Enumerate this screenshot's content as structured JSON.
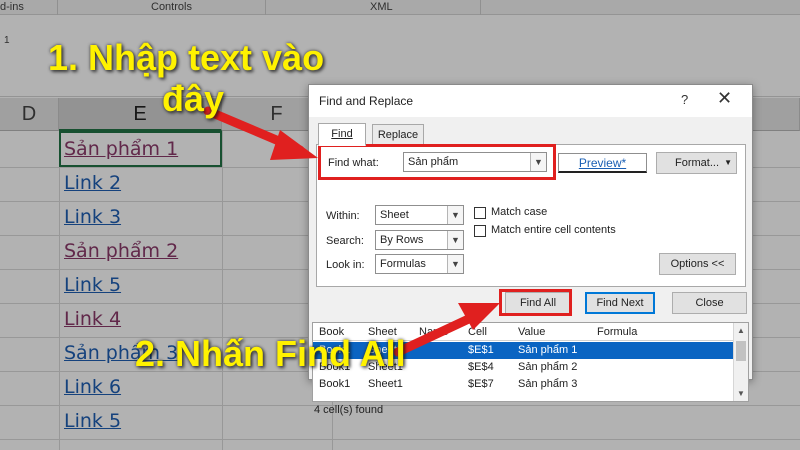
{
  "ribbon": {
    "addins": "d-ins",
    "controls": "Controls",
    "xml": "XML"
  },
  "formula_row_number": "1",
  "columns": {
    "d": "D",
    "e": "E",
    "f": "F"
  },
  "cells": [
    {
      "text": "Sản phẩm 1",
      "style": "visited"
    },
    {
      "text": "Link 2",
      "style": "link"
    },
    {
      "text": "Link 3",
      "style": "link"
    },
    {
      "text": "Sản phẩm 2",
      "style": "visited"
    },
    {
      "text": "Link 5",
      "style": "link"
    },
    {
      "text": "Link 4",
      "style": "visited"
    },
    {
      "text": "Sản phẩm 3",
      "style": "link"
    },
    {
      "text": "Link 6",
      "style": "link"
    },
    {
      "text": "Link 5",
      "style": "link"
    }
  ],
  "dialog": {
    "title": "Find and Replace",
    "help": "?",
    "close": "✕",
    "tabs": {
      "find": "Find",
      "replace": "Replace"
    },
    "find_what_label": "Find what:",
    "find_what_value": "Sản phẩm",
    "preview": "Preview*",
    "format_button": "Format...",
    "within_label": "Within:",
    "within_value": "Sheet",
    "search_label": "Search:",
    "search_value": "By Rows",
    "lookin_label": "Look in:",
    "lookin_value": "Formulas",
    "match_case": "Match case",
    "match_entire": "Match entire cell contents",
    "options_button": "Options <<",
    "find_all": "Find All",
    "find_next": "Find Next",
    "close_button": "Close",
    "results": {
      "headers": {
        "book": "Book",
        "sheet": "Sheet",
        "name": "Name",
        "cell": "Cell",
        "value": "Value",
        "formula": "Formula"
      },
      "rows": [
        {
          "book": "Book1",
          "sheet": "Sheet1",
          "cell": "$E$1",
          "value": "Sản phẩm 1"
        },
        {
          "book": "Book1",
          "sheet": "Sheet1",
          "cell": "$E$4",
          "value": "Sản phẩm 2"
        },
        {
          "book": "Book1",
          "sheet": "Sheet1",
          "cell": "$E$7",
          "value": "Sản phẩm 3"
        }
      ]
    },
    "status": "4 cell(s) found"
  },
  "annotations": {
    "step1_line1": "1. Nhập text vào",
    "step1_line2": "đây",
    "step2": "2. Nhấn Find All"
  },
  "colors": {
    "annotation_text": "#fff200",
    "highlight_box": "#e0201f",
    "excel_green": "#217346",
    "link": "#1f5fb4",
    "visited": "#8b3a6b"
  }
}
